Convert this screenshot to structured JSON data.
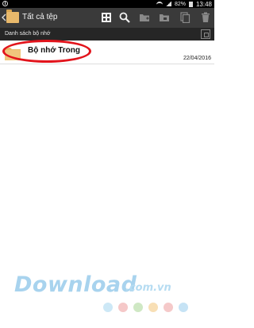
{
  "status_bar": {
    "battery": "82%",
    "time": "13:48"
  },
  "app_bar": {
    "title": "Tất cả tệp"
  },
  "list_header": {
    "label": "Danh sách bộ nhớ"
  },
  "items": [
    {
      "name": "Bộ nhớ Trong",
      "date": "22/04/2016"
    }
  ],
  "watermark": {
    "brand": "Download",
    "suffix": ".com.vn"
  },
  "colors": {
    "app_bar": "#3a3a3a",
    "list_header": "#262626",
    "folder": "#e8b96b",
    "highlight": "#e2141c",
    "watermark_dots": [
      "#cde8f6",
      "#f5c8c8",
      "#cfe8c4",
      "#f8dfb5",
      "#f5c9c9",
      "#c6e3f5"
    ]
  },
  "icons": [
    "back-chevron",
    "folder",
    "select-all",
    "search",
    "move-folder",
    "copy-folder",
    "copy",
    "delete",
    "grid-view"
  ]
}
